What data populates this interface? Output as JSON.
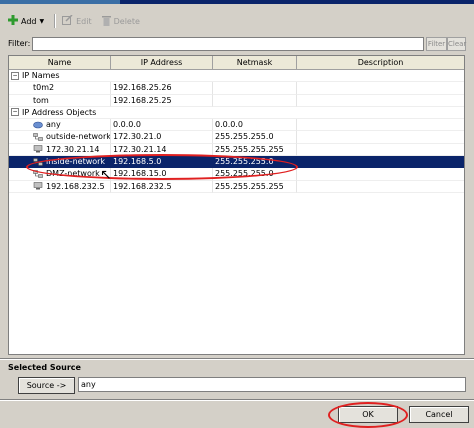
{
  "toolbar": {
    "add_label": "Add",
    "edit_label": "Edit",
    "delete_label": "Delete"
  },
  "filter": {
    "label": "Filter:",
    "value": "",
    "filter_button": "Filter",
    "clear_button": "Clear"
  },
  "table": {
    "columns": [
      "Name",
      "IP Address",
      "Netmask",
      "Description"
    ],
    "groups": [
      {
        "name": "IP Names",
        "toggle": "−",
        "rows": [
          {
            "name": "t0m2",
            "ip": "192.168.25.26",
            "netmask": "",
            "description": "",
            "icon": "none"
          },
          {
            "name": "tom",
            "ip": "192.168.25.25",
            "netmask": "",
            "description": "",
            "icon": "none"
          }
        ]
      },
      {
        "name": "IP Address Objects",
        "toggle": "−",
        "rows": [
          {
            "name": "any",
            "ip": "0.0.0.0",
            "netmask": "0.0.0.0",
            "description": "",
            "icon": "network-cloud-icon"
          },
          {
            "name": "outside-network",
            "ip": "172.30.21.0",
            "netmask": "255.255.255.0",
            "description": "",
            "icon": "network-icon"
          },
          {
            "name": "172.30.21.14",
            "ip": "172.30.21.14",
            "netmask": "255.255.255.255",
            "description": "",
            "icon": "host-icon"
          },
          {
            "name": "inside-network",
            "ip": "192.168.5.0",
            "netmask": "255.255.255.0",
            "description": "",
            "icon": "network-icon",
            "selected": true
          },
          {
            "name": "DMZ-network",
            "ip": "192.168.15.0",
            "netmask": "255.255.255.0",
            "description": "",
            "icon": "network-icon"
          },
          {
            "name": "192.168.232.5",
            "ip": "192.168.232.5",
            "netmask": "255.255.255.255",
            "description": "",
            "icon": "host-icon"
          }
        ]
      }
    ]
  },
  "selected_source": {
    "title": "Selected Source",
    "button_label": "Source ->",
    "value": "any"
  },
  "dialog": {
    "ok_label": "OK",
    "cancel_label": "Cancel"
  },
  "colors": {
    "selection": "#0a246a",
    "annotation": "#e02020",
    "add_icon": "#2e9a2e"
  }
}
